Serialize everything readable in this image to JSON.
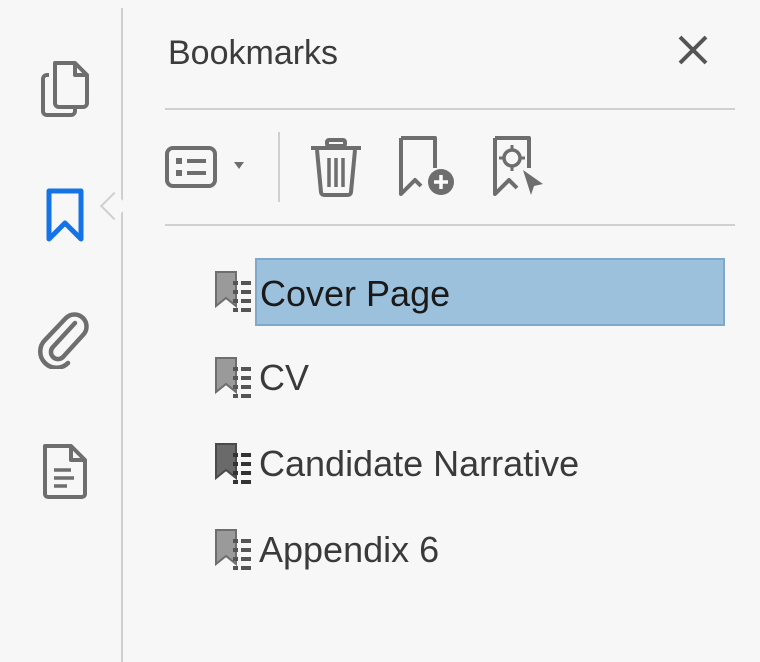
{
  "panel": {
    "title": "Bookmarks"
  },
  "rail": {
    "items": [
      {
        "icon": "pages-icon",
        "active": false
      },
      {
        "icon": "bookmark-icon",
        "active": true
      },
      {
        "icon": "attachment-icon",
        "active": false
      },
      {
        "icon": "document-icon",
        "active": false
      }
    ]
  },
  "toolbar": {
    "options_icon": "options-list-icon",
    "delete_icon": "trash-icon",
    "new_bookmark_icon": "add-bookmark-icon",
    "bookmark_selection_icon": "bookmark-target-icon"
  },
  "bookmarks": [
    {
      "label": "Cover Page",
      "selected": true
    },
    {
      "label": "CV",
      "selected": false
    },
    {
      "label": "Candidate Narrative",
      "selected": false
    },
    {
      "label": "Appendix 6",
      "selected": false
    }
  ],
  "colors": {
    "accent": "#1473e6",
    "selection": "#9bc1dd",
    "icon": "#6e6e6e"
  }
}
